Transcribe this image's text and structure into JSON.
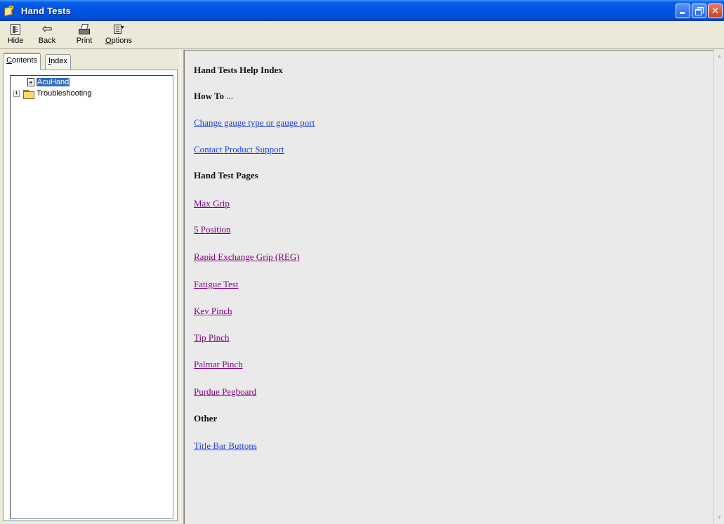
{
  "window": {
    "title": "Hand Tests",
    "colors": {
      "titlebar": "#0054E3",
      "link": "#1B3EDB",
      "visited_link": "#800080",
      "selection": "#316AC5"
    }
  },
  "toolbar": {
    "hide_label": "Hide",
    "back_label": "Back",
    "print_label": "Print",
    "options_label_underlined": "O",
    "options_label_rest": "ptions"
  },
  "tabs": {
    "contents_underlined": "C",
    "contents_rest": "ontents",
    "index_underlined": "I",
    "index_rest": "ndex"
  },
  "tree": {
    "items": [
      {
        "label": "AcuHand",
        "icon": "page-icon",
        "selected": true
      },
      {
        "label": "Troubleshooting",
        "icon": "folder-icon",
        "expander": "+"
      }
    ]
  },
  "content": {
    "title": "Hand Tests Help Index",
    "howto_heading": "How To",
    "howto_ellipsis": " ...",
    "howto_links": [
      "Change gauge type or gauge port",
      "Contact Product Support"
    ],
    "pages_heading": "Hand Test Pages",
    "pages_links": [
      "Max Grip",
      "5 Position",
      "Rapid Exchange Grip (REG)",
      "Fatigue Test",
      "Key Pinch",
      "Tip Pinch",
      "Palmar Pinch",
      "Purdue Pegboard"
    ],
    "other_heading": "Other",
    "other_links": [
      "Title Bar Buttons"
    ]
  }
}
